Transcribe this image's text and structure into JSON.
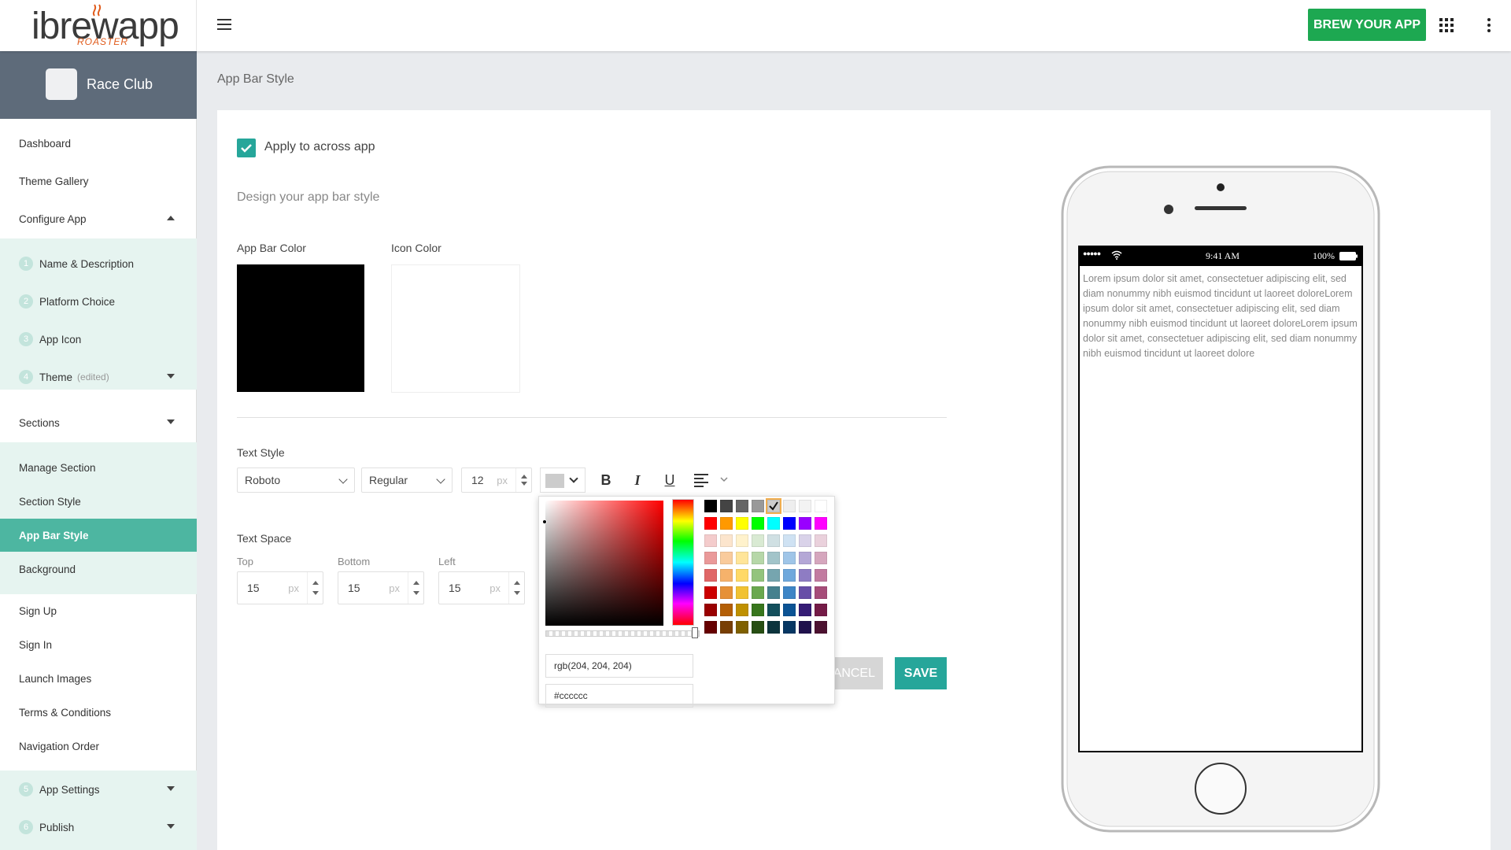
{
  "app": {
    "logo_text": "ibrewapp",
    "logo_sub": "ROASTER",
    "brew_button": "BREW YOUR APP",
    "brand_color": "#1da851",
    "accent_color": "#26a69a"
  },
  "sidebar": {
    "club_name": "Race Club",
    "items": [
      {
        "label": "Dashboard"
      },
      {
        "label": "Theme Gallery"
      },
      {
        "label": "Configure App"
      }
    ],
    "steps": [
      {
        "num": "1",
        "label": "Name & Description"
      },
      {
        "num": "2",
        "label": "Platform Choice"
      },
      {
        "num": "3",
        "label": "App Icon"
      },
      {
        "num": "4",
        "label": "Theme",
        "note": "(edited)"
      }
    ],
    "sections_label": "Sections",
    "section_items": [
      {
        "label": "Manage Section"
      },
      {
        "label": "Section Style"
      },
      {
        "label": "App Bar Style"
      },
      {
        "label": "Background"
      }
    ],
    "other_items": [
      {
        "label": "Sign Up"
      },
      {
        "label": "Sign In"
      },
      {
        "label": "Launch Images"
      },
      {
        "label": "Terms & Conditions"
      },
      {
        "label": "Navigation Order"
      }
    ],
    "bottom_steps": [
      {
        "num": "5",
        "label": "App Settings"
      },
      {
        "num": "6",
        "label": "Publish"
      }
    ]
  },
  "main": {
    "page_title": "App Bar Style",
    "apply_label": "Apply to across app",
    "design_label": "Design your app bar style",
    "app_bar_color_label": "App Bar Color",
    "app_bar_color": "#000000",
    "icon_color_label": "Icon Color",
    "icon_color": "#ffffff",
    "text_style_label": "Text Style",
    "font": "Roboto",
    "weight": "Regular",
    "size": "12",
    "unit": "px",
    "text_space_label": "Text Space",
    "top_label": "Top",
    "top_value": "15",
    "bottom_label": "Bottom",
    "bottom_value": "15",
    "left_label": "Left",
    "left_value": "15",
    "cancel": "CANCEL",
    "save": "SAVE"
  },
  "picker": {
    "rgb": "rgb(204, 204, 204)",
    "hex": "#cccccc",
    "palette": [
      [
        "#000000",
        "#444444",
        "#666666",
        "#999999",
        "#cccccc",
        "#eeeeee",
        "#f3f3f3",
        "#ffffff"
      ],
      [
        "#ff0000",
        "#ff9900",
        "#ffff00",
        "#00ff00",
        "#00ffff",
        "#0000ff",
        "#9900ff",
        "#ff00ff"
      ],
      [
        "#f4cccc",
        "#fce5cd",
        "#fff2cc",
        "#d9ead3",
        "#d0e0e3",
        "#cfe2f3",
        "#d9d2e9",
        "#ead1dc"
      ],
      [
        "#ea9999",
        "#f9cb9c",
        "#ffe599",
        "#b6d7a8",
        "#a2c4c9",
        "#9fc5e8",
        "#b4a7d6",
        "#d5a6bd"
      ],
      [
        "#e06666",
        "#f6b26b",
        "#ffd966",
        "#93c47d",
        "#76a5af",
        "#6fa8dc",
        "#8e7cc3",
        "#c27ba0"
      ],
      [
        "#cc0000",
        "#e69138",
        "#f1c232",
        "#6aa84f",
        "#45818e",
        "#3d85c6",
        "#674ea7",
        "#a64d79"
      ],
      [
        "#990000",
        "#b45f06",
        "#bf9000",
        "#38761d",
        "#134f5c",
        "#0b5394",
        "#351c75",
        "#741b47"
      ],
      [
        "#660000",
        "#783f04",
        "#7f6000",
        "#274e13",
        "#0c343d",
        "#073763",
        "#20124d",
        "#4c1130"
      ]
    ]
  },
  "phone": {
    "carrier_dots": "●●●●●",
    "time": "9:41 AM",
    "battery": "100%",
    "lorem": "Lorem ipsum dolor sit amet, consectetuer adipiscing elit, sed diam nonummy nibh euismod tincidunt ut laoreet doloreLorem ipsum dolor sit amet, consectetuer adipiscing elit, sed diam nonummy nibh euismod tincidunt ut laoreet doloreLorem ipsum dolor sit amet, consectetuer adipiscing elit, sed diam nonummy nibh euismod tincidunt ut laoreet dolore"
  }
}
